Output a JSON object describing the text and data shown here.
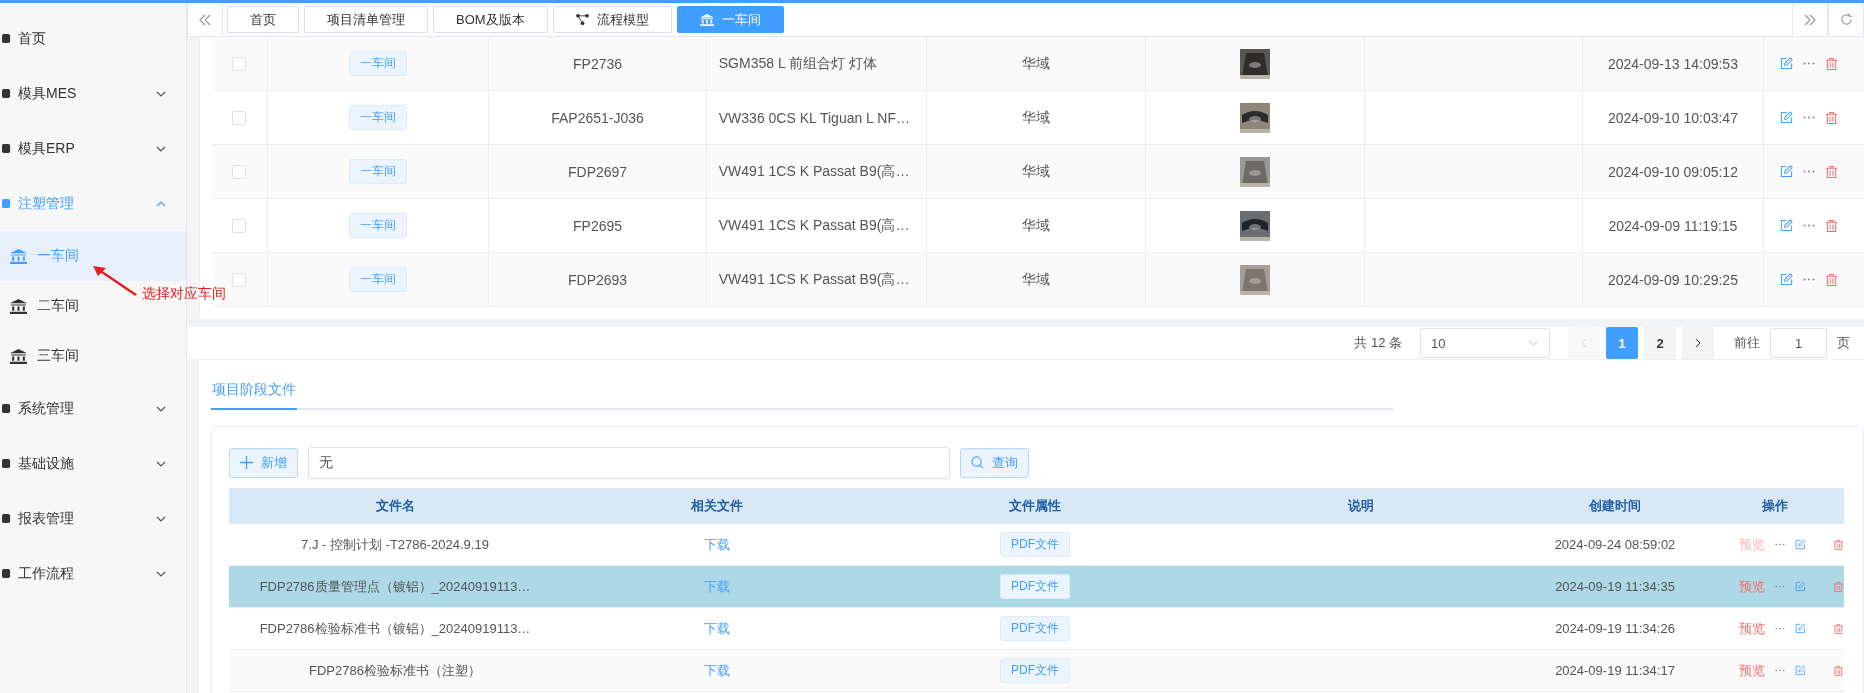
{
  "sidebar": {
    "items": [
      {
        "label": "首页",
        "kind": "link"
      },
      {
        "label": "模具MES",
        "kind": "group",
        "expanded": false
      },
      {
        "label": "模具ERP",
        "kind": "group",
        "expanded": false
      },
      {
        "label": "注塑管理",
        "kind": "group",
        "expanded": true,
        "children": [
          {
            "label": "一车间",
            "selected": true
          },
          {
            "label": "二车间",
            "selected": false
          },
          {
            "label": "三车间",
            "selected": false
          }
        ]
      },
      {
        "label": "系统管理",
        "kind": "group",
        "expanded": false
      },
      {
        "label": "基础设施",
        "kind": "group",
        "expanded": false
      },
      {
        "label": "报表管理",
        "kind": "group",
        "expanded": false
      },
      {
        "label": "工作流程",
        "kind": "group",
        "expanded": false
      }
    ]
  },
  "annotation": {
    "text": "选择对应车间"
  },
  "tabs": [
    {
      "label": "首页",
      "kind": "plain",
      "selected": false
    },
    {
      "label": "项目清单管理",
      "kind": "plain",
      "selected": false
    },
    {
      "label": "BOM及版本",
      "kind": "plain",
      "selected": false
    },
    {
      "label": "流程模型",
      "kind": "flow",
      "selected": false
    },
    {
      "label": "一车间",
      "kind": "workshop",
      "selected": true
    }
  ],
  "records": {
    "rows": [
      {
        "checked": false,
        "workshop": "一车间",
        "code": "FP2736",
        "name": "SGM358 L 前组合灯 灯体",
        "supplier": "华域",
        "created": "2024-09-13 14:09:53"
      },
      {
        "checked": false,
        "workshop": "一车间",
        "code": "FAP2651-J036",
        "name": "VW336 0CS KL Tiguan L NF…",
        "supplier": "华域",
        "created": "2024-09-10 10:03:47"
      },
      {
        "checked": false,
        "workshop": "一车间",
        "code": "FDP2697",
        "name": "VW491 1CS K Passat B9(高…",
        "supplier": "华域",
        "created": "2024-09-10 09:05:12"
      },
      {
        "checked": false,
        "workshop": "一车间",
        "code": "FP2695",
        "name": "VW491 1CS K Passat B9(高…",
        "supplier": "华域",
        "created": "2024-09-09 11:19:15"
      },
      {
        "checked": false,
        "workshop": "一车间",
        "code": "FDP2693",
        "name": "VW491 1CS K Passat B9(高…",
        "supplier": "华域",
        "created": "2024-09-09 10:29:25"
      }
    ]
  },
  "pagination": {
    "total": "共 12 条",
    "page_size": "10",
    "prev_disabled": true,
    "pages": [
      {
        "label": "1",
        "selected": true
      },
      {
        "label": "2",
        "selected": false
      }
    ],
    "goto_label": "前往",
    "goto_value": "1",
    "page_unit": "页"
  },
  "files": {
    "tab": {
      "label": "项目阶段文件",
      "selected": true
    },
    "add_button": "新增",
    "search": {
      "value": "无"
    },
    "query_button": "查询",
    "columns": [
      "文件名",
      "相关文件",
      "文件属性",
      "说明",
      "创建时间",
      "操作"
    ],
    "rows": [
      {
        "name": "7.J - 控制计划 -T2786-2024.9.19",
        "related": "下载",
        "type": "PDF文件",
        "created": "2024-09-24 08:59:02",
        "preview": "预览",
        "preview_disabled": true,
        "selected": false
      },
      {
        "name": "FDP2786质量管理点（镀铝）_20240919113…",
        "related": "下载",
        "type": "PDF文件",
        "created": "2024-09-19 11:34:35",
        "preview": "预览",
        "preview_disabled": false,
        "selected": true
      },
      {
        "name": "FDP2786检验标准书（镀铝）_20240919113…",
        "related": "下载",
        "type": "PDF文件",
        "created": "2024-09-19 11:34:26",
        "preview": "预览",
        "preview_disabled": false,
        "selected": false
      },
      {
        "name": "FDP2786检验标准书（注塑）",
        "related": "下载",
        "type": "PDF文件",
        "created": "2024-09-19 11:34:17",
        "preview": "预览",
        "preview_disabled": false,
        "selected": false
      }
    ]
  }
}
